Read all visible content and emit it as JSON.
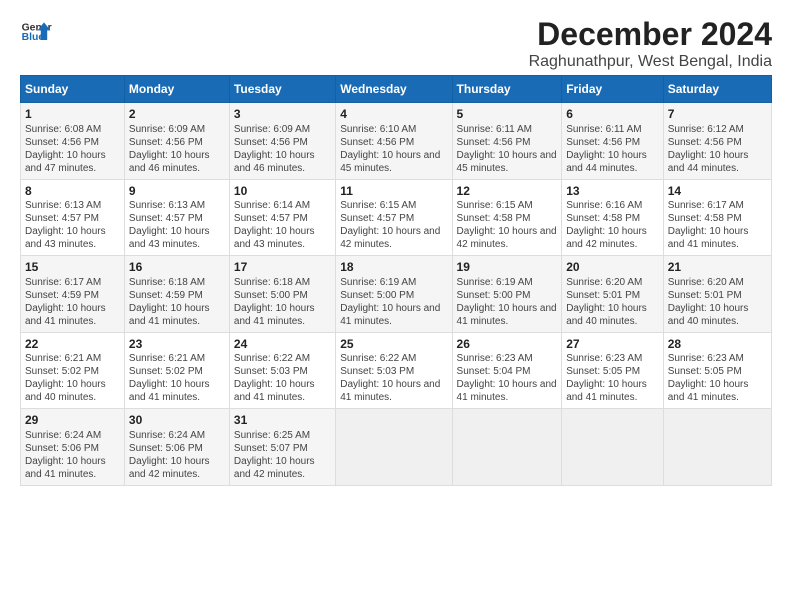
{
  "logo": {
    "line1": "General",
    "line2": "Blue"
  },
  "title": "December 2024",
  "subtitle": "Raghunathpur, West Bengal, India",
  "header": {
    "accent_color": "#1a6bb5"
  },
  "days_of_week": [
    "Sunday",
    "Monday",
    "Tuesday",
    "Wednesday",
    "Thursday",
    "Friday",
    "Saturday"
  ],
  "weeks": [
    {
      "cells": [
        {
          "day": "1",
          "sunrise": "6:08 AM",
          "sunset": "4:56 PM",
          "daylight": "10 hours and 47 minutes."
        },
        {
          "day": "2",
          "sunrise": "6:09 AM",
          "sunset": "4:56 PM",
          "daylight": "10 hours and 46 minutes."
        },
        {
          "day": "3",
          "sunrise": "6:09 AM",
          "sunset": "4:56 PM",
          "daylight": "10 hours and 46 minutes."
        },
        {
          "day": "4",
          "sunrise": "6:10 AM",
          "sunset": "4:56 PM",
          "daylight": "10 hours and 45 minutes."
        },
        {
          "day": "5",
          "sunrise": "6:11 AM",
          "sunset": "4:56 PM",
          "daylight": "10 hours and 45 minutes."
        },
        {
          "day": "6",
          "sunrise": "6:11 AM",
          "sunset": "4:56 PM",
          "daylight": "10 hours and 44 minutes."
        },
        {
          "day": "7",
          "sunrise": "6:12 AM",
          "sunset": "4:56 PM",
          "daylight": "10 hours and 44 minutes."
        }
      ]
    },
    {
      "cells": [
        {
          "day": "8",
          "sunrise": "6:13 AM",
          "sunset": "4:57 PM",
          "daylight": "10 hours and 43 minutes."
        },
        {
          "day": "9",
          "sunrise": "6:13 AM",
          "sunset": "4:57 PM",
          "daylight": "10 hours and 43 minutes."
        },
        {
          "day": "10",
          "sunrise": "6:14 AM",
          "sunset": "4:57 PM",
          "daylight": "10 hours and 43 minutes."
        },
        {
          "day": "11",
          "sunrise": "6:15 AM",
          "sunset": "4:57 PM",
          "daylight": "10 hours and 42 minutes."
        },
        {
          "day": "12",
          "sunrise": "6:15 AM",
          "sunset": "4:58 PM",
          "daylight": "10 hours and 42 minutes."
        },
        {
          "day": "13",
          "sunrise": "6:16 AM",
          "sunset": "4:58 PM",
          "daylight": "10 hours and 42 minutes."
        },
        {
          "day": "14",
          "sunrise": "6:17 AM",
          "sunset": "4:58 PM",
          "daylight": "10 hours and 41 minutes."
        }
      ]
    },
    {
      "cells": [
        {
          "day": "15",
          "sunrise": "6:17 AM",
          "sunset": "4:59 PM",
          "daylight": "10 hours and 41 minutes."
        },
        {
          "day": "16",
          "sunrise": "6:18 AM",
          "sunset": "4:59 PM",
          "daylight": "10 hours and 41 minutes."
        },
        {
          "day": "17",
          "sunrise": "6:18 AM",
          "sunset": "5:00 PM",
          "daylight": "10 hours and 41 minutes."
        },
        {
          "day": "18",
          "sunrise": "6:19 AM",
          "sunset": "5:00 PM",
          "daylight": "10 hours and 41 minutes."
        },
        {
          "day": "19",
          "sunrise": "6:19 AM",
          "sunset": "5:00 PM",
          "daylight": "10 hours and 41 minutes."
        },
        {
          "day": "20",
          "sunrise": "6:20 AM",
          "sunset": "5:01 PM",
          "daylight": "10 hours and 40 minutes."
        },
        {
          "day": "21",
          "sunrise": "6:20 AM",
          "sunset": "5:01 PM",
          "daylight": "10 hours and 40 minutes."
        }
      ]
    },
    {
      "cells": [
        {
          "day": "22",
          "sunrise": "6:21 AM",
          "sunset": "5:02 PM",
          "daylight": "10 hours and 40 minutes."
        },
        {
          "day": "23",
          "sunrise": "6:21 AM",
          "sunset": "5:02 PM",
          "daylight": "10 hours and 41 minutes."
        },
        {
          "day": "24",
          "sunrise": "6:22 AM",
          "sunset": "5:03 PM",
          "daylight": "10 hours and 41 minutes."
        },
        {
          "day": "25",
          "sunrise": "6:22 AM",
          "sunset": "5:03 PM",
          "daylight": "10 hours and 41 minutes."
        },
        {
          "day": "26",
          "sunrise": "6:23 AM",
          "sunset": "5:04 PM",
          "daylight": "10 hours and 41 minutes."
        },
        {
          "day": "27",
          "sunrise": "6:23 AM",
          "sunset": "5:05 PM",
          "daylight": "10 hours and 41 minutes."
        },
        {
          "day": "28",
          "sunrise": "6:23 AM",
          "sunset": "5:05 PM",
          "daylight": "10 hours and 41 minutes."
        }
      ]
    },
    {
      "cells": [
        {
          "day": "29",
          "sunrise": "6:24 AM",
          "sunset": "5:06 PM",
          "daylight": "10 hours and 41 minutes."
        },
        {
          "day": "30",
          "sunrise": "6:24 AM",
          "sunset": "5:06 PM",
          "daylight": "10 hours and 42 minutes."
        },
        {
          "day": "31",
          "sunrise": "6:25 AM",
          "sunset": "5:07 PM",
          "daylight": "10 hours and 42 minutes."
        },
        null,
        null,
        null,
        null
      ]
    }
  ]
}
